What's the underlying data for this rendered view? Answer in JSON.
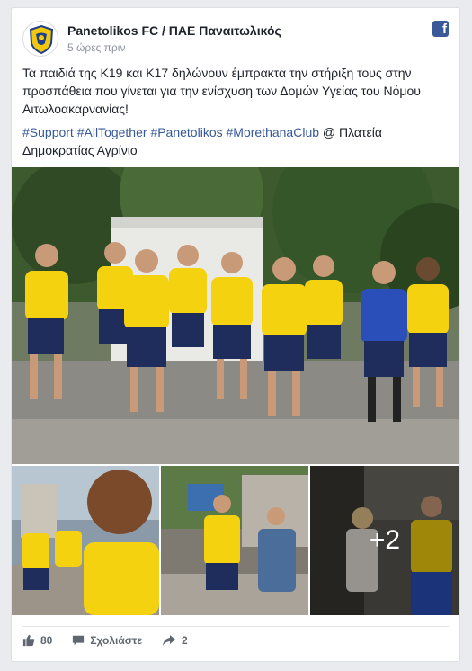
{
  "post": {
    "page_name": "Panetolikos FC / ΠΑΕ Παναιτωλικός",
    "time": "5 ώρες πριν",
    "text_line": "Τα παιδιά της Κ19 και Κ17 δηλώνουν έμπρακτα την στήριξη τους στην προσπάθεια που γίνεται για την ενίσχυση των Δομών Υγείας του Νόμου Αιτωλοακαρνανίας!",
    "hashtags": [
      "#Support",
      "#AllTogether",
      "#Panetolikos",
      "#MorethanaClub"
    ],
    "location_text": "@ Πλατεία Δημοκρατίας Αγρίνιο",
    "more_photos": "+2"
  },
  "footer": {
    "likes": "80",
    "comment_label": "Σχολιάστε",
    "shares": "2"
  },
  "colors": {
    "facebook_blue": "#3b5998",
    "hashtag": "#365899",
    "jersey_yellow": "#f5d20f",
    "shorts_navy": "#1f2d5c"
  }
}
